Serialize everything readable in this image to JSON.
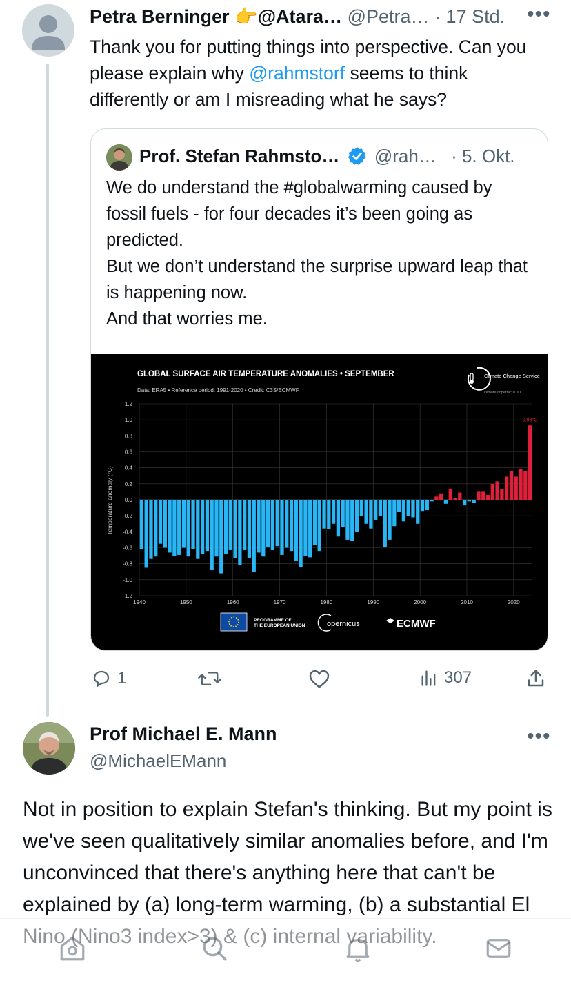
{
  "reply_tweet": {
    "display_name": "Petra Berninger",
    "name_suffix": "👉@Atara…",
    "handle": "@Petra…",
    "time": "· 17 Std.",
    "text_before_mention": "Thank you for putting things into perspective. Can you please explain why ",
    "mention": "@rahmstorf",
    "text_after_mention": " seems to think differently or am I misreading what he says?",
    "more_icon": "more-icon"
  },
  "quoted_tweet": {
    "display_name": "Prof. Stefan Rahmsto…",
    "handle": "@rah…",
    "time": "· 5. Okt.",
    "verified_icon": "verified-badge-icon",
    "lines": [
      "We do understand the #globalwarming caused by fossil fuels - for four decades it’s been going as predicted.",
      "But we don’t understand the surprise upward leap that is happening now.",
      "And that worries me."
    ]
  },
  "chart_data": {
    "type": "bar",
    "title": "GLOBAL SURFACE AIR TEMPERATURE ANOMALIES • SEPTEMBER",
    "subtitle": "Data: ERA5 • Reference period: 1991-2020 • Credit: C3S/ECMWF",
    "ylabel": "Temperature anomaly (°C)",
    "xlabel": "",
    "ylim": [
      -1.2,
      1.2
    ],
    "yticks": [
      "1.2",
      "1.0",
      "0.8",
      "0.6",
      "0.4",
      "0.2",
      "0.0",
      "-0.2",
      "-0.4",
      "-0.6",
      "-0.8",
      "-1.0",
      "-1.2"
    ],
    "xticks": [
      "1940",
      "1950",
      "1960",
      "1970",
      "1980",
      "1990",
      "2000",
      "2010",
      "2020"
    ],
    "grid": true,
    "annotation": "+0.93°C",
    "logo_text": "Climate Change Service",
    "logo_url_text": "climate.copernicus.eu",
    "footer_logos": [
      "PROGRAMME OF THE EUROPEAN UNION",
      "opernicus",
      "ECMWF"
    ],
    "colors": {
      "negative": "#29b6f6",
      "positive": "#e0203a",
      "background": "#000000"
    },
    "years": [
      1940,
      1941,
      1942,
      1943,
      1944,
      1945,
      1946,
      1947,
      1948,
      1949,
      1950,
      1951,
      1952,
      1953,
      1954,
      1955,
      1956,
      1957,
      1958,
      1959,
      1960,
      1961,
      1962,
      1963,
      1964,
      1965,
      1966,
      1967,
      1968,
      1969,
      1970,
      1971,
      1972,
      1973,
      1974,
      1975,
      1976,
      1977,
      1978,
      1979,
      1980,
      1981,
      1982,
      1983,
      1984,
      1985,
      1986,
      1987,
      1988,
      1989,
      1990,
      1991,
      1992,
      1993,
      1994,
      1995,
      1996,
      1997,
      1998,
      1999,
      2000,
      2001,
      2002,
      2003,
      2004,
      2005,
      2006,
      2007,
      2008,
      2009,
      2010,
      2011,
      2012,
      2013,
      2014,
      2015,
      2016,
      2017,
      2018,
      2019,
      2020,
      2021,
      2022,
      2023
    ],
    "values": [
      -0.62,
      -0.85,
      -0.74,
      -0.71,
      -0.55,
      -0.6,
      -0.66,
      -0.7,
      -0.69,
      -0.6,
      -0.71,
      -0.62,
      -0.74,
      -0.68,
      -0.64,
      -0.88,
      -0.71,
      -0.92,
      -0.68,
      -0.63,
      -0.73,
      -0.82,
      -0.63,
      -0.73,
      -0.9,
      -0.66,
      -0.71,
      -0.59,
      -0.63,
      -0.58,
      -0.69,
      -0.6,
      -0.64,
      -0.76,
      -0.84,
      -0.7,
      -0.72,
      -0.57,
      -0.64,
      -0.36,
      -0.37,
      -0.3,
      -0.46,
      -0.34,
      -0.5,
      -0.51,
      -0.4,
      -0.2,
      -0.3,
      -0.36,
      -0.25,
      -0.2,
      -0.59,
      -0.5,
      -0.33,
      -0.15,
      -0.27,
      -0.2,
      -0.22,
      -0.3,
      -0.14,
      -0.13,
      -0.02,
      0.04,
      0.08,
      -0.05,
      0.14,
      0.02,
      0.09,
      -0.07,
      -0.02,
      -0.04,
      0.1,
      0.1,
      0.06,
      0.2,
      0.23,
      0.13,
      0.29,
      0.36,
      0.29,
      0.38,
      0.36,
      0.93
    ]
  },
  "quote_actions": {
    "reply_count": "1",
    "views": "307"
  },
  "main_tweet": {
    "display_name": "Prof Michael E. Mann",
    "handle": "@MichaelEMann",
    "text": "Not in position to explain Stefan's thinking. But my point is we've seen qualitatively similar anomalies before, and I'm unconvinced that there's anything here that can't be explained by (a) long-term warming, (b) a substantial El Nino (Nino3 index>3) & (c) internal variability."
  },
  "bottom_nav": [
    "home-icon",
    "search-icon",
    "notifications-icon",
    "messages-icon"
  ]
}
